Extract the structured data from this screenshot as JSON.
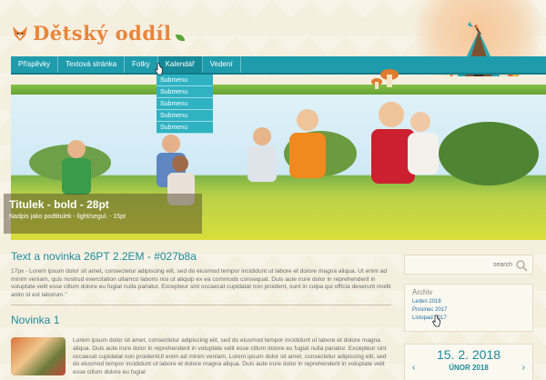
{
  "site": {
    "title": "Dětský oddíl"
  },
  "nav": {
    "items": [
      "Příspěvky",
      "Textová stránka",
      "Fotky",
      "Kalendář",
      "Vedení"
    ],
    "active": 3,
    "submenu": [
      "Submenu",
      "Submenu",
      "Submenu",
      "Submenu",
      "Submenu"
    ]
  },
  "hero": {
    "title": "Titulek - bold - 28pt",
    "subtitle": "Nadpis jako podtitulek - light/segul. - 15pt"
  },
  "main": {
    "intro_title": "Text a novinka 26PT 2.2EM - #027b8a",
    "intro_text": "17px - Lorem ipsum dolor sit amet, consectetur adipiscing elit, sed do eiusmod tempor incididunt ut labore et dolore magna aliqua. Ut enim ad minim veniam, quis nostrud exercitation ullamco laboris nisi ut aliquip ex ea commodo consequat. Duis aute irure dolor in reprehenderit in voluptate velit esse cillum dolore eu fugiat nulla pariatur. Excepteur sint occaecat cupidatat non proident, sunt in culpa qui officia deserunt mollit anim id est laborum.\"",
    "news_title": "Novinka 1",
    "news_text": "Lorem ipsum dolor sit amet, consectetur adipiscing elit, sed do eiusmod tempor incididunt ut labore et dolore magna aliqua. Duis aute irure dolor in reprehenderit in voluptate velit esse cillum dolore eu fugiat nulla pariatur. Excepteur sint occaecat cupidatat non proidentUt enim ad minim veniam, Lorem ipsum dolor sit amet, consectetur adipiscing elit, sed do eiusmod tempor incididunt ut labore et dolore magna aliqua. Duis aute irure dolor in reprehenderit in voluptate velit esse cillum dolore eu fugiat"
  },
  "sidebar": {
    "search_placeholder": "search",
    "archive_title": "Archiv",
    "archive_items": [
      "Leden 2018",
      "Prosinec 2017",
      "Listopad 2017"
    ],
    "calendar_date": "15. 2. 2018",
    "calendar_month": "ÚNOR 2018",
    "prev_arrow": "‹",
    "next_arrow": "›"
  },
  "colors": {
    "accent": "#1f9cac",
    "logo": "#e9853a",
    "link": "#1e6fa8"
  },
  "icons": [
    "fox-icon",
    "leaf-icon",
    "tent-icon",
    "search-icon",
    "cursor-icon"
  ]
}
